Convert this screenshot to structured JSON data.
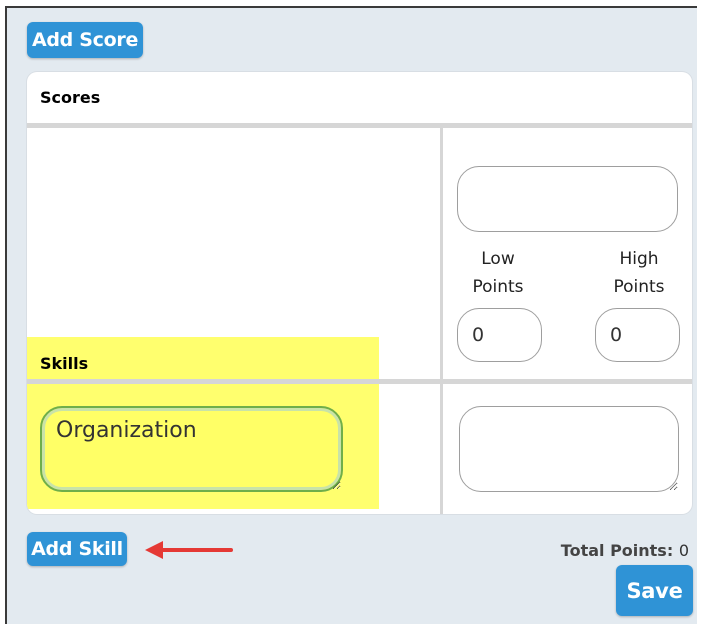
{
  "toolbar": {
    "add_score_label": "Add Score"
  },
  "panel": {
    "header_title": "Scores",
    "skills_label": "Skills",
    "score_column": {
      "name_value": "",
      "low_points_label": "Low Points",
      "high_points_label": "High Points",
      "low_points_value": "0",
      "high_points_value": "0"
    },
    "skill_rows": [
      {
        "name_value": "Organization",
        "description_value": ""
      }
    ]
  },
  "footer": {
    "add_skill_label": "Add Skill",
    "total_points_label": "Total Points:",
    "total_points_value": "0",
    "save_label": "Save"
  },
  "colors": {
    "accent": "#2f93d6",
    "highlight": "#ffff55",
    "arrow": "#e53935"
  }
}
